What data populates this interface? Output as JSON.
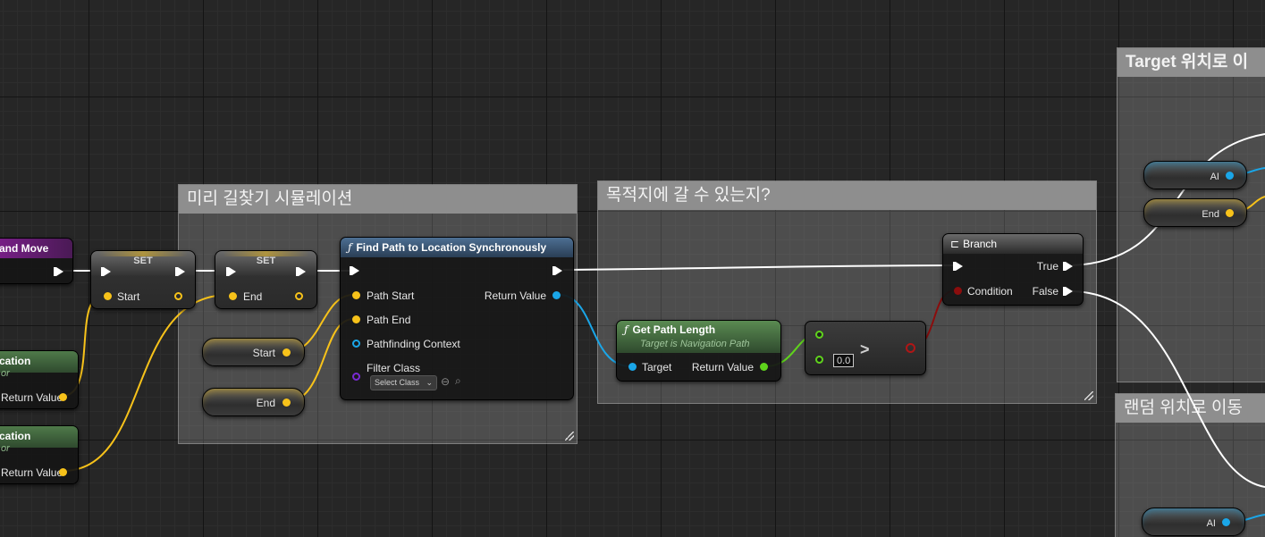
{
  "comments": {
    "pathfind_sim": "미리 길찾기 시뮬레이션",
    "can_reach": "목적지에 갈 수 있는지?",
    "move_to_target": "Target 위치로 이",
    "move_to_random": "랜덤 위치로 이동"
  },
  "nodes": {
    "event_partial_title": "and Move",
    "loc1": {
      "title": "cation",
      "subtitle": "or",
      "return_label": "Return Value"
    },
    "loc2": {
      "title": "cation",
      "subtitle": "or",
      "return_label": "Return Value"
    },
    "set1": {
      "title": "SET",
      "pin_label": "Start"
    },
    "set2": {
      "title": "SET",
      "pin_label": "End"
    },
    "var_start": {
      "label": "Start"
    },
    "var_end": {
      "label": "End"
    },
    "find_path": {
      "icon": "ƒ",
      "title": "Find Path to Location Synchronously",
      "pins": {
        "path_start": "Path Start",
        "path_end": "Path End",
        "pathfinding_context": "Pathfinding Context",
        "filter_class": "Filter Class",
        "return_value": "Return Value"
      },
      "select_class": "Select Class"
    },
    "get_path_length": {
      "icon": "ƒ",
      "title": "Get Path Length",
      "subtitle": "Target is Navigation Path",
      "target_label": "Target",
      "return_label": "Return Value"
    },
    "compare": {
      "operator": ">",
      "value": "0.0"
    },
    "branch": {
      "title": "Branch",
      "condition": "Condition",
      "true_label": "True",
      "false_label": "False"
    },
    "var_ai_top": {
      "label": "AI"
    },
    "var_end_top": {
      "label": "End"
    },
    "var_ai_bottom": {
      "label": "AI"
    }
  },
  "colors": {
    "exec": "#ffffff",
    "vector_pin": "#f7c21a",
    "object_pin": "#1aa6e8",
    "float_pin": "#5fd31c",
    "bool_pin": "#8b0d0d",
    "class_pin": "#7a2ad4",
    "function_header": "#3a5a7c",
    "pure_function_header": "#4f7a4a",
    "event_header": "#7b1f8a",
    "comment_title": "#8e8e8e"
  }
}
